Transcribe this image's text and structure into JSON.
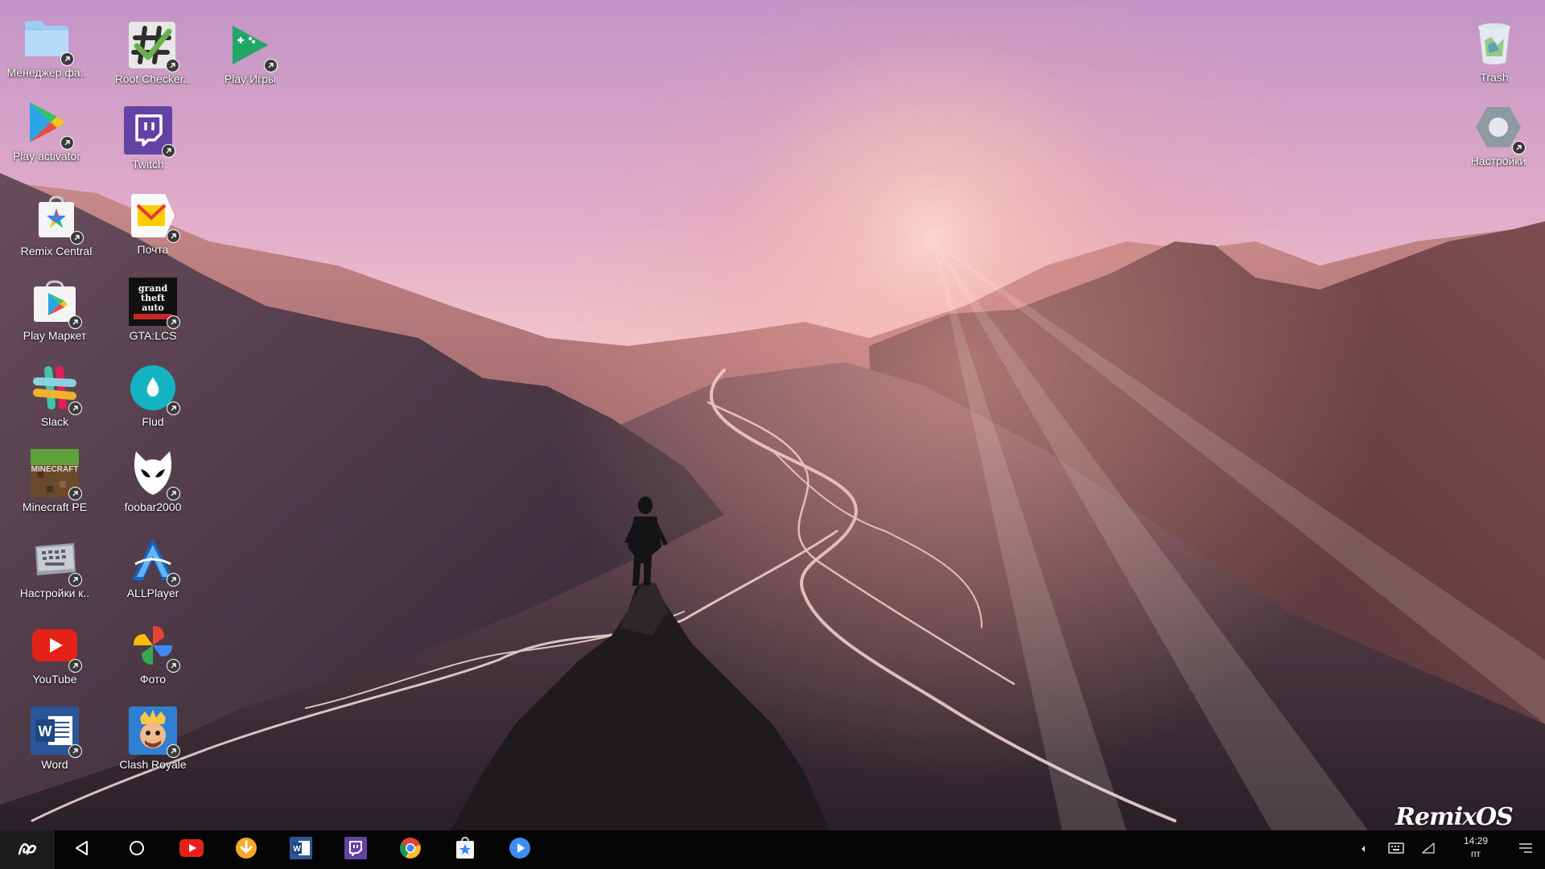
{
  "desktop": {
    "icons": {
      "file_manager": "Менеджер фа..",
      "root_checker": "Root Checker..",
      "play_games": "Play Игры",
      "play_activator": "Play activator",
      "twitch": "Twitch",
      "remix_central": "Remix Central",
      "mail": "Почта",
      "play_market": "Play Маркет",
      "gta_lcs": "GTA:LCS",
      "slack": "Slack",
      "flud": "Flud",
      "minecraft": "Minecraft PE",
      "foobar": "foobar2000",
      "keyboard_settings": "Настройки к..",
      "allplayer": "ALLPlayer",
      "youtube": "YouTube",
      "photos": "Фото",
      "word": "Word",
      "clash_royale": "Clash Royale",
      "trash": "Trash",
      "settings": "Настройки"
    },
    "icon_images": {
      "gta_logo": [
        "grand",
        "theft",
        "auto"
      ],
      "minecraft_logo": "MINECRAFT"
    },
    "brand_logo": "RemixOS"
  },
  "taskbar": {
    "pinned": [
      "youtube",
      "downloader",
      "word",
      "twitch",
      "chrome",
      "remix-central",
      "video-player"
    ],
    "clock": {
      "time": "14:29",
      "day": "пт"
    }
  },
  "colors": {
    "taskbar_bg": "#050505",
    "sky_top": "#c79bbf",
    "sky_horizon": "#f2cdd0"
  }
}
